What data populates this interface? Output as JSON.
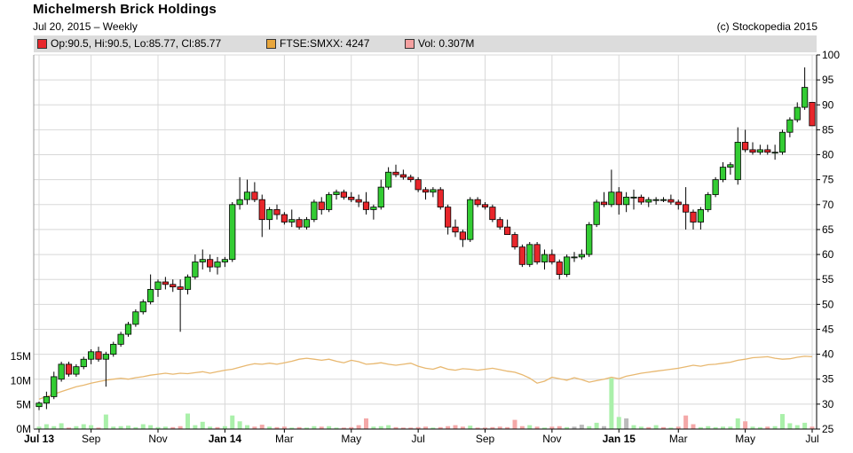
{
  "header": {
    "title": "Michelmersh Brick Holdings",
    "subtitle": "Jul 20, 2015 – Weekly",
    "copyright": "(c) Stockopedia 2015"
  },
  "legend": [
    {
      "label": "Op:90.5, Hi:90.5, Lo:85.77, Cl:85.77",
      "color": "#e8262b"
    },
    {
      "label": "FTSE:SMXX: 4247",
      "color": "#e8a63c"
    },
    {
      "label": "Vol: 0.307M",
      "color": "#f4a0a0"
    }
  ],
  "colors": {
    "up": "#33cc33",
    "down": "#e8262b",
    "line": "#e8b870",
    "vol_up": "#aaf0aa",
    "vol_down": "#f4a8a8",
    "vol_flat": "#bbbbbb"
  },
  "chart_data": {
    "type": "candlestick",
    "price_axis": {
      "side": "right",
      "range": [
        25,
        100
      ],
      "ticks": [
        "100",
        "95",
        "90",
        "85",
        "80",
        "75",
        "70",
        "65",
        "60",
        "55",
        "50",
        "45",
        "40",
        "35",
        "30",
        "25"
      ]
    },
    "volume_axis": {
      "side": "left",
      "unit": "M",
      "range": [
        0,
        15
      ],
      "ticks": [
        "15M",
        "10M",
        "5M",
        "0M"
      ]
    },
    "x_labels": [
      {
        "label": "Jul 13",
        "week": 0,
        "bold": true
      },
      {
        "label": "Sep",
        "week": 7,
        "bold": false
      },
      {
        "label": "Nov",
        "week": 16,
        "bold": false
      },
      {
        "label": "Jan 14",
        "week": 25,
        "bold": true
      },
      {
        "label": "Mar",
        "week": 33,
        "bold": false
      },
      {
        "label": "May",
        "week": 42,
        "bold": false
      },
      {
        "label": "Jul",
        "week": 51,
        "bold": false
      },
      {
        "label": "Sep",
        "week": 60,
        "bold": false
      },
      {
        "label": "Nov",
        "week": 69,
        "bold": false
      },
      {
        "label": "Jan 15",
        "week": 78,
        "bold": true
      },
      {
        "label": "Mar",
        "week": 86,
        "bold": false
      },
      {
        "label": "May",
        "week": 95,
        "bold": false
      },
      {
        "label": "Jul",
        "week": 104,
        "bold": false
      }
    ],
    "candles": [
      [
        29.5,
        30.5,
        28.8,
        30.2
      ],
      [
        30.2,
        32.5,
        29.0,
        31.5
      ],
      [
        31.5,
        36.5,
        31.0,
        35.5
      ],
      [
        35.0,
        38.5,
        34.5,
        38.0
      ],
      [
        38.0,
        38.5,
        35.5,
        36.0
      ],
      [
        36.0,
        38.0,
        35.5,
        37.5
      ],
      [
        37.5,
        39.5,
        37.0,
        39.0
      ],
      [
        39.0,
        41.0,
        38.0,
        40.5
      ],
      [
        40.5,
        41.5,
        38.5,
        39.0
      ],
      [
        39.0,
        40.5,
        33.5,
        40.0
      ],
      [
        40.0,
        42.5,
        39.5,
        42.0
      ],
      [
        42.0,
        44.5,
        41.5,
        44.0
      ],
      [
        44.0,
        46.5,
        43.5,
        46.0
      ],
      [
        46.0,
        49.0,
        45.5,
        48.5
      ],
      [
        48.5,
        51.0,
        48.0,
        50.5
      ],
      [
        50.5,
        56.0,
        50.0,
        53.0
      ],
      [
        53.0,
        55.0,
        51.5,
        54.5
      ],
      [
        54.5,
        55.5,
        53.0,
        54.0
      ],
      [
        54.0,
        55.0,
        52.5,
        53.5
      ],
      [
        53.5,
        55.0,
        44.5,
        53.0
      ],
      [
        53.0,
        56.0,
        52.0,
        55.5
      ],
      [
        55.5,
        60.0,
        55.0,
        58.5
      ],
      [
        58.5,
        61.0,
        57.0,
        59.0
      ],
      [
        59.0,
        60.0,
        56.5,
        57.5
      ],
      [
        57.5,
        59.5,
        56.0,
        58.5
      ],
      [
        58.5,
        59.5,
        57.5,
        59.0
      ],
      [
        59.0,
        70.5,
        58.5,
        70.0
      ],
      [
        70.0,
        75.5,
        69.0,
        71.0
      ],
      [
        71.0,
        75.0,
        70.0,
        72.5
      ],
      [
        72.5,
        74.5,
        70.5,
        71.0
      ],
      [
        71.0,
        72.0,
        63.5,
        67.0
      ],
      [
        67.0,
        69.5,
        65.0,
        69.0
      ],
      [
        69.0,
        70.0,
        67.0,
        68.0
      ],
      [
        68.0,
        68.5,
        66.0,
        66.5
      ],
      [
        66.5,
        69.0,
        65.5,
        67.0
      ],
      [
        67.0,
        67.5,
        65.0,
        65.5
      ],
      [
        65.5,
        67.5,
        65.0,
        67.0
      ],
      [
        67.0,
        71.0,
        66.5,
        70.5
      ],
      [
        70.5,
        71.5,
        68.0,
        69.0
      ],
      [
        69.0,
        72.5,
        68.5,
        72.0
      ],
      [
        72.0,
        73.0,
        71.0,
        72.5
      ],
      [
        72.5,
        73.0,
        71.0,
        71.5
      ],
      [
        71.5,
        72.5,
        70.5,
        71.0
      ],
      [
        71.0,
        72.0,
        69.5,
        70.5
      ],
      [
        70.5,
        72.5,
        68.0,
        69.0
      ],
      [
        69.0,
        70.0,
        67.0,
        69.5
      ],
      [
        69.5,
        75.0,
        69.0,
        73.5
      ],
      [
        73.5,
        77.5,
        73.0,
        76.5
      ],
      [
        76.5,
        78.0,
        75.5,
        76.0
      ],
      [
        76.0,
        77.0,
        75.0,
        75.5
      ],
      [
        75.5,
        76.0,
        74.5,
        75.0
      ],
      [
        75.0,
        75.5,
        72.5,
        73.0
      ],
      [
        73.0,
        73.5,
        71.0,
        72.5
      ],
      [
        72.5,
        73.5,
        71.5,
        73.0
      ],
      [
        73.0,
        73.5,
        69.0,
        69.5
      ],
      [
        69.5,
        70.0,
        64.0,
        65.5
      ],
      [
        65.5,
        67.0,
        63.5,
        64.5
      ],
      [
        64.5,
        65.0,
        61.5,
        63.0
      ],
      [
        63.0,
        71.5,
        62.5,
        71.0
      ],
      [
        71.0,
        71.5,
        69.5,
        70.0
      ],
      [
        70.0,
        70.5,
        69.0,
        69.5
      ],
      [
        69.5,
        70.0,
        66.5,
        67.0
      ],
      [
        67.0,
        67.5,
        65.0,
        65.5
      ],
      [
        65.5,
        67.0,
        64.0,
        64.0
      ],
      [
        64.0,
        64.5,
        61.0,
        61.5
      ],
      [
        61.5,
        62.0,
        57.5,
        58.0
      ],
      [
        58.0,
        62.5,
        57.5,
        62.0
      ],
      [
        62.0,
        62.5,
        58.0,
        58.5
      ],
      [
        58.5,
        61.0,
        57.0,
        60.0
      ],
      [
        60.0,
        61.0,
        58.0,
        58.5
      ],
      [
        58.5,
        59.0,
        55.0,
        56.0
      ],
      [
        56.0,
        60.0,
        55.5,
        59.5
      ],
      [
        59.5,
        60.5,
        58.5,
        59.5
      ],
      [
        59.5,
        61.0,
        59.0,
        60.0
      ],
      [
        60.0,
        66.5,
        59.5,
        66.0
      ],
      [
        66.0,
        71.0,
        65.5,
        70.5
      ],
      [
        70.5,
        72.5,
        69.5,
        70.0
      ],
      [
        70.0,
        77.0,
        69.5,
        72.5
      ],
      [
        72.5,
        73.5,
        68.0,
        70.0
      ],
      [
        70.0,
        72.5,
        68.5,
        71.5
      ],
      [
        71.5,
        73.0,
        69.0,
        71.5
      ],
      [
        71.5,
        72.0,
        70.0,
        70.5
      ],
      [
        70.5,
        71.5,
        69.5,
        71.0
      ],
      [
        71.0,
        71.5,
        70.0,
        71.0
      ],
      [
        71.0,
        71.5,
        70.5,
        71.0
      ],
      [
        71.0,
        72.0,
        70.0,
        70.5
      ],
      [
        70.5,
        71.0,
        69.0,
        70.0
      ],
      [
        70.0,
        73.5,
        65.0,
        68.5
      ],
      [
        68.5,
        69.0,
        65.0,
        66.5
      ],
      [
        66.5,
        69.5,
        65.0,
        69.0
      ],
      [
        69.0,
        72.5,
        68.5,
        72.0
      ],
      [
        72.0,
        75.5,
        71.5,
        75.0
      ],
      [
        75.0,
        78.5,
        74.5,
        77.5
      ],
      [
        77.5,
        78.5,
        76.0,
        78.0
      ],
      [
        75.0,
        85.5,
        74.0,
        82.5
      ],
      [
        82.5,
        85.0,
        80.5,
        81.0
      ],
      [
        81.0,
        82.5,
        80.0,
        80.5
      ],
      [
        80.5,
        82.0,
        80.0,
        81.0
      ],
      [
        81.0,
        82.0,
        80.0,
        80.5
      ],
      [
        80.5,
        82.0,
        79.0,
        80.5
      ],
      [
        80.5,
        85.0,
        80.0,
        84.5
      ],
      [
        84.5,
        87.5,
        83.5,
        87.0
      ],
      [
        87.0,
        90.5,
        86.5,
        89.5
      ],
      [
        89.5,
        97.5,
        89.0,
        93.5
      ],
      [
        90.5,
        90.5,
        85.8,
        85.8
      ]
    ],
    "volume_M": [
      [
        0.5,
        1
      ],
      [
        1.0,
        1
      ],
      [
        0.6,
        1
      ],
      [
        1.2,
        1
      ],
      [
        0.3,
        0
      ],
      [
        0.6,
        1
      ],
      [
        1.0,
        1
      ],
      [
        0.8,
        1
      ],
      [
        0.3,
        0
      ],
      [
        3.0,
        1
      ],
      [
        0.5,
        1
      ],
      [
        0.6,
        1
      ],
      [
        0.7,
        1
      ],
      [
        0.4,
        1
      ],
      [
        1.0,
        1
      ],
      [
        0.8,
        1
      ],
      [
        0.4,
        1
      ],
      [
        0.5,
        1
      ],
      [
        0.4,
        0
      ],
      [
        0.6,
        0
      ],
      [
        3.2,
        1
      ],
      [
        0.8,
        1
      ],
      [
        1.5,
        1
      ],
      [
        0.5,
        1
      ],
      [
        0.4,
        0
      ],
      [
        0.6,
        1
      ],
      [
        2.8,
        1
      ],
      [
        1.6,
        1
      ],
      [
        0.8,
        1
      ],
      [
        0.5,
        0
      ],
      [
        0.9,
        0
      ],
      [
        0.5,
        1
      ],
      [
        0.4,
        0
      ],
      [
        0.5,
        0
      ],
      [
        0.3,
        1
      ],
      [
        0.4,
        0
      ],
      [
        0.3,
        1
      ],
      [
        0.6,
        1
      ],
      [
        0.5,
        0
      ],
      [
        0.6,
        1
      ],
      [
        0.3,
        1
      ],
      [
        0.3,
        0
      ],
      [
        0.4,
        0
      ],
      [
        0.8,
        0
      ],
      [
        2.2,
        0
      ],
      [
        0.5,
        1
      ],
      [
        0.6,
        1
      ],
      [
        0.8,
        1
      ],
      [
        0.4,
        0
      ],
      [
        0.3,
        0
      ],
      [
        0.3,
        0
      ],
      [
        0.4,
        0
      ],
      [
        0.5,
        0
      ],
      [
        0.3,
        1
      ],
      [
        0.4,
        0
      ],
      [
        0.6,
        0
      ],
      [
        0.8,
        0
      ],
      [
        0.5,
        0
      ],
      [
        0.7,
        1
      ],
      [
        0.3,
        0
      ],
      [
        0.3,
        0
      ],
      [
        0.4,
        0
      ],
      [
        0.5,
        0
      ],
      [
        0.4,
        0
      ],
      [
        1.9,
        0
      ],
      [
        0.6,
        0
      ],
      [
        0.8,
        1
      ],
      [
        0.5,
        0
      ],
      [
        0.3,
        1
      ],
      [
        0.5,
        0
      ],
      [
        0.6,
        0
      ],
      [
        0.4,
        1
      ],
      [
        0.5,
        2
      ],
      [
        0.9,
        2
      ],
      [
        0.6,
        1
      ],
      [
        1.3,
        1
      ],
      [
        0.6,
        2
      ],
      [
        10.5,
        1
      ],
      [
        2.5,
        1
      ],
      [
        2.2,
        2
      ],
      [
        0.8,
        1
      ],
      [
        0.5,
        1
      ],
      [
        0.4,
        0
      ],
      [
        0.8,
        1
      ],
      [
        0.4,
        0
      ],
      [
        0.3,
        1
      ],
      [
        0.5,
        0
      ],
      [
        2.8,
        0
      ],
      [
        1.0,
        0
      ],
      [
        0.4,
        1
      ],
      [
        0.6,
        1
      ],
      [
        0.4,
        1
      ],
      [
        0.5,
        1
      ],
      [
        0.5,
        1
      ],
      [
        2.2,
        1
      ],
      [
        1.6,
        0
      ],
      [
        0.5,
        1
      ],
      [
        0.4,
        1
      ],
      [
        0.5,
        0
      ],
      [
        0.6,
        1
      ],
      [
        3.1,
        1
      ],
      [
        1.2,
        1
      ],
      [
        0.8,
        1
      ],
      [
        1.3,
        1
      ],
      [
        0.5,
        0
      ]
    ],
    "index_line": [
      31.0,
      31.5,
      32.0,
      32.5,
      33.0,
      33.5,
      33.8,
      34.2,
      34.5,
      34.8,
      35.0,
      35.2,
      35.0,
      35.3,
      35.5,
      35.8,
      36.0,
      36.2,
      36.0,
      36.2,
      36.1,
      36.3,
      36.5,
      36.2,
      36.5,
      36.8,
      37.0,
      37.4,
      37.8,
      38.1,
      38.0,
      38.2,
      38.0,
      38.3,
      38.6,
      39.0,
      39.2,
      39.0,
      38.8,
      39.0,
      38.6,
      38.3,
      38.8,
      38.5,
      38.0,
      38.1,
      38.3,
      38.0,
      37.8,
      38.0,
      38.2,
      37.6,
      37.2,
      37.0,
      37.5,
      37.0,
      36.8,
      37.1,
      37.0,
      36.8,
      37.0,
      37.2,
      36.9,
      36.6,
      36.4,
      35.9,
      35.2,
      34.2,
      34.6,
      35.4,
      35.1,
      34.8,
      35.3,
      34.9,
      34.4,
      34.7,
      35.0,
      35.4,
      35.1,
      35.6,
      35.9,
      36.2,
      36.4,
      36.6,
      36.8,
      37.0,
      37.2,
      37.5,
      37.8,
      37.6,
      37.9,
      38.0,
      38.2,
      38.4,
      38.8,
      39.0,
      39.3,
      39.4,
      39.5,
      39.2,
      39.0,
      39.1,
      39.4,
      39.6,
      39.5
    ]
  }
}
